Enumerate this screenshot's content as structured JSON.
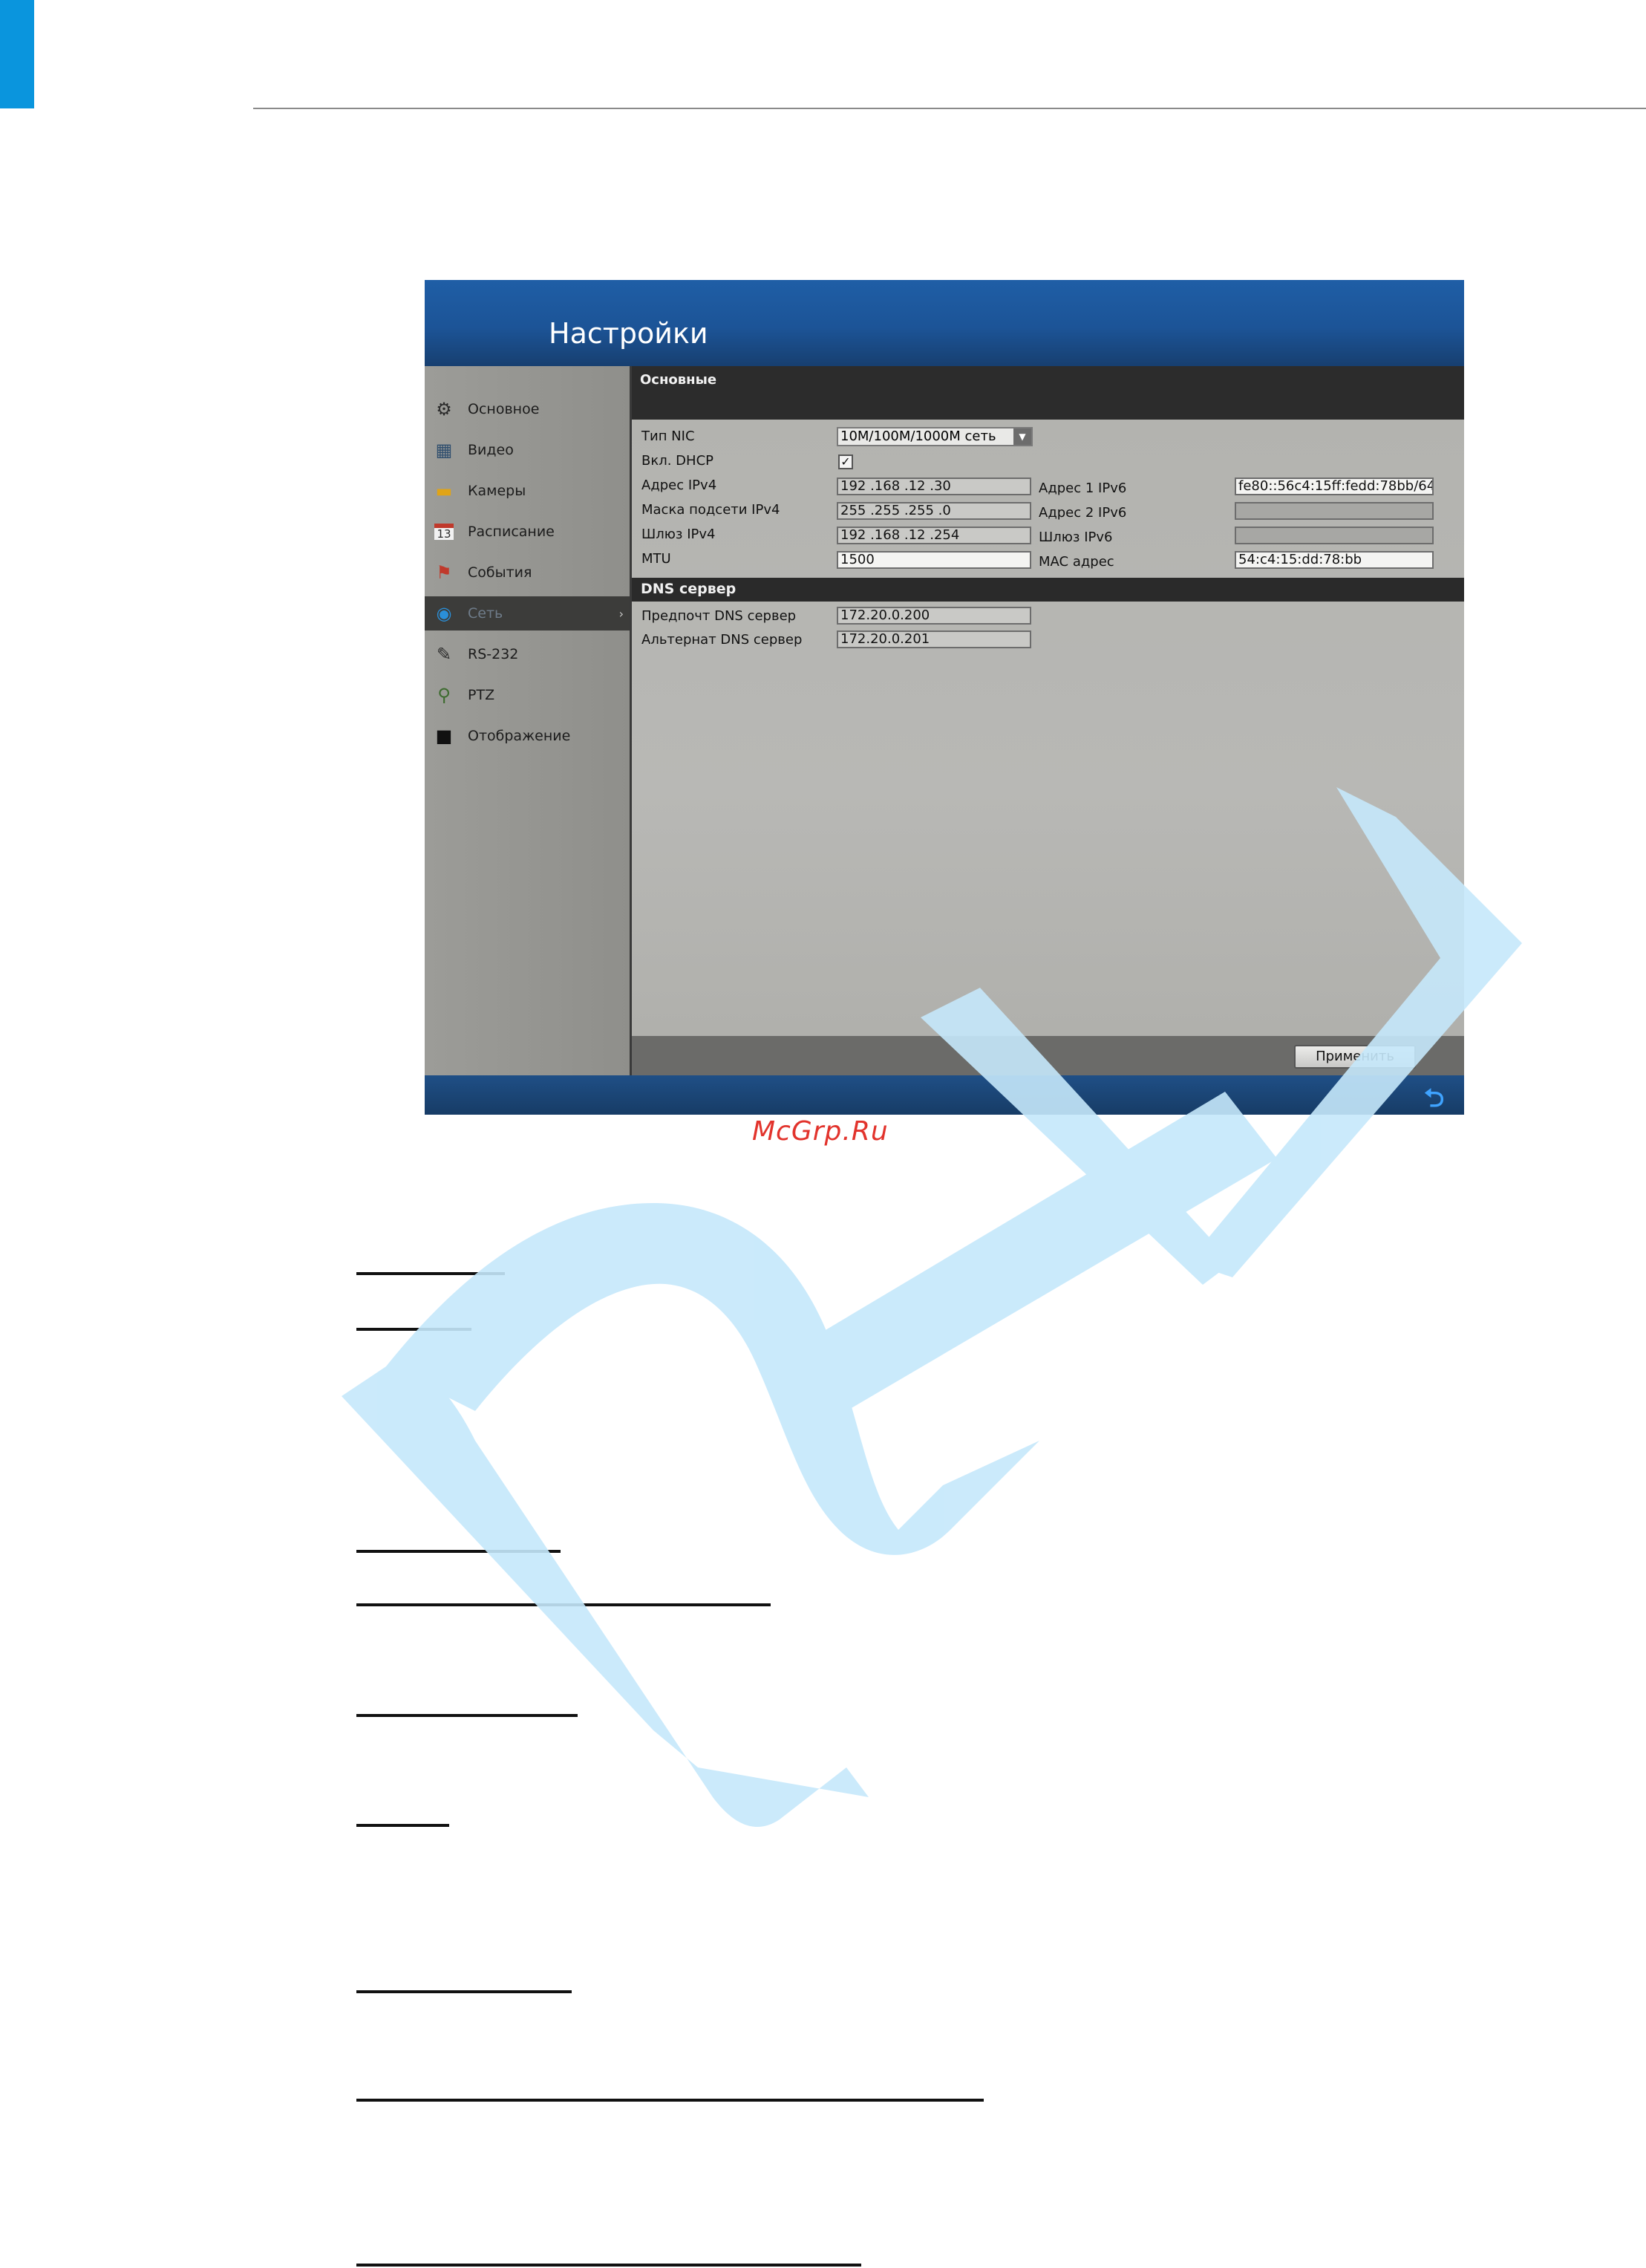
{
  "screen": {
    "title": "Настройки",
    "sidebar": {
      "items": [
        {
          "label": "Основное",
          "icon": "gear-icon",
          "glyph": "⚙"
        },
        {
          "label": "Видео",
          "icon": "monitor-icon",
          "glyph": "▦"
        },
        {
          "label": "Камеры",
          "icon": "folder-camera-icon",
          "glyph": "▬"
        },
        {
          "label": "Расписание",
          "icon": "calendar-icon",
          "glyph": "13"
        },
        {
          "label": "События",
          "icon": "flag-icon",
          "glyph": "⚑"
        },
        {
          "label": "Сеть",
          "icon": "globe-icon",
          "glyph": "◉"
        },
        {
          "label": "RS-232",
          "icon": "serial-port-icon",
          "glyph": "✎"
        },
        {
          "label": "PTZ",
          "icon": "ptz-camera-icon",
          "glyph": "⚲"
        },
        {
          "label": "Отображение",
          "icon": "display-icon",
          "glyph": "■"
        }
      ],
      "active_index": 5
    },
    "section_title": "Основные",
    "form": {
      "nic_type_label": "Тип NIC",
      "nic_type_value": "10M/100M/1000M сеть",
      "dhcp_label": "Вкл. DHCP",
      "dhcp_checked": "✓",
      "ipv4_label": "Адрес IPv4",
      "ipv4_value": "192 .168 .12   .30",
      "mask_label": "Маска подсети IPv4",
      "mask_value": "255 .255 .255 .0",
      "gateway_label": "Шлюз IPv4",
      "gateway_value": "192 .168 .12   .254",
      "mtu_label": "MTU",
      "mtu_value": "1500",
      "ipv6_1_label": "Адрес 1 IPv6",
      "ipv6_1_value": "fe80::56c4:15ff:fedd:78bb/64",
      "ipv6_2_label": "Адрес 2 IPv6",
      "ipv6_2_value": "",
      "gateway6_label": "Шлюз IPv6",
      "gateway6_value": "",
      "mac_label": "MAC адрес",
      "mac_value": "54:c4:15:dd:78:bb"
    },
    "dns": {
      "title": "DNS сервер",
      "preferred_label": "Предпочт DNS сервер",
      "preferred_value": "172.20.0.200",
      "alternate_label": "Альтернат DNS сервер",
      "alternate_value": "172.20.0.201"
    },
    "apply_label": "Применить",
    "back_glyph": "⮌"
  },
  "caption": "McGrp.Ru",
  "colors": {
    "corner_tab": "#0a95dd",
    "watermark": "#c5e8fb",
    "caption": "#e2332c"
  }
}
